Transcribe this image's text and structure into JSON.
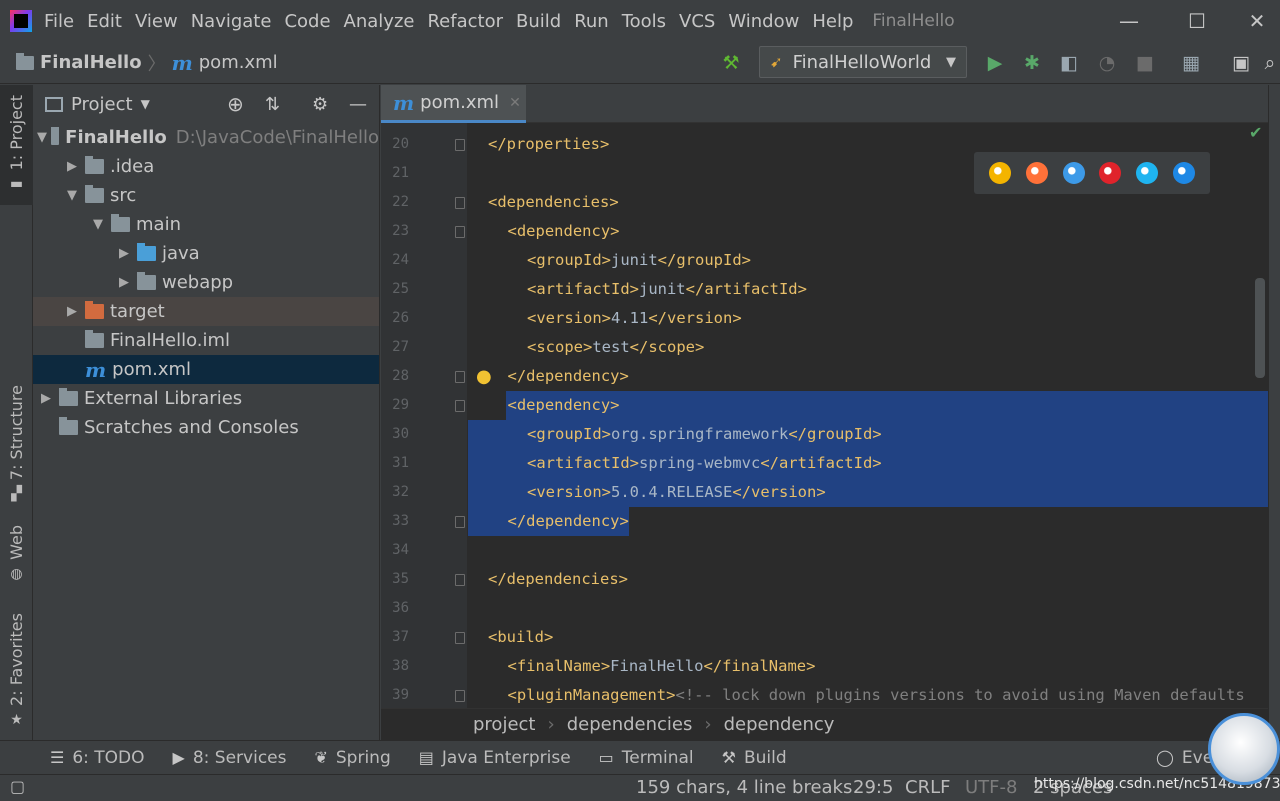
{
  "window": {
    "menu": [
      "File",
      "Edit",
      "View",
      "Navigate",
      "Code",
      "Analyze",
      "Refactor",
      "Build",
      "Run",
      "Tools",
      "VCS",
      "Window",
      "Help"
    ],
    "title": "FinalHello",
    "minimize": "—",
    "maximize": "☐",
    "close": "✕"
  },
  "navbar": {
    "project": "FinalHello",
    "file": "pom.xml",
    "run_config": "FinalHelloWorld"
  },
  "left_strip": {
    "project": "1: Project",
    "structure": "7: Structure",
    "web": "Web",
    "favorites": "2: Favorites"
  },
  "project_panel": {
    "title": "Project",
    "tree": [
      {
        "label": "FinalHello",
        "hint": "D:\\JavaCode\\FinalHello",
        "arrow": "▼",
        "indent": 0,
        "icon": "module-icon",
        "color": "#87939a"
      },
      {
        "label": ".idea",
        "arrow": "▶",
        "indent": 1,
        "icon": "folder-icon",
        "color": "#87939a"
      },
      {
        "label": "src",
        "arrow": "▼",
        "indent": 1,
        "icon": "folder-icon",
        "color": "#87939a"
      },
      {
        "label": "main",
        "arrow": "▼",
        "indent": 2,
        "icon": "folder-icon",
        "color": "#87939a"
      },
      {
        "label": "java",
        "arrow": "▶",
        "indent": 3,
        "icon": "source-folder-icon",
        "color": "#4a9fd8"
      },
      {
        "label": "webapp",
        "arrow": "▶",
        "indent": 3,
        "icon": "web-folder-icon",
        "color": "#87939a"
      },
      {
        "label": "target",
        "arrow": "▶",
        "indent": 1,
        "icon": "excluded-folder-icon",
        "color": "#d26b3f"
      },
      {
        "label": "FinalHello.iml",
        "arrow": "",
        "indent": 1,
        "icon": "iml-file-icon",
        "color": "#87939a"
      },
      {
        "label": "pom.xml",
        "arrow": "",
        "indent": 1,
        "icon": "maven-file-icon",
        "color": "#3d8fd8"
      },
      {
        "label": "External Libraries",
        "arrow": "▶",
        "indent": 0,
        "icon": "libraries-icon",
        "color": "#87939a"
      },
      {
        "label": "Scratches and Consoles",
        "arrow": "",
        "indent": 0,
        "icon": "scratches-icon",
        "color": "#87939a"
      }
    ]
  },
  "editor": {
    "tab": "pom.xml",
    "lines": [
      {
        "no": "20",
        "indent": 0,
        "text": "</properties>"
      },
      {
        "no": "21",
        "indent": 0,
        "text": ""
      },
      {
        "no": "22",
        "indent": 0,
        "text": "<dependencies>"
      },
      {
        "no": "23",
        "indent": 1,
        "text": "<dependency>"
      },
      {
        "no": "24",
        "indent": 2,
        "text": "<groupId>junit</groupId>"
      },
      {
        "no": "25",
        "indent": 2,
        "text": "<artifactId>junit</artifactId>"
      },
      {
        "no": "26",
        "indent": 2,
        "text": "<version>4.11</version>"
      },
      {
        "no": "27",
        "indent": 2,
        "text": "<scope>test</scope>"
      },
      {
        "no": "28",
        "indent": 1,
        "text": "</dependency>"
      },
      {
        "no": "29",
        "indent": 1,
        "text": "<dependency>"
      },
      {
        "no": "30",
        "indent": 2,
        "text": "<groupId>org.springframework</groupId>"
      },
      {
        "no": "31",
        "indent": 2,
        "text": "<artifactId>spring-webmvc</artifactId>"
      },
      {
        "no": "32",
        "indent": 2,
        "text": "<version>5.0.4.RELEASE</version>"
      },
      {
        "no": "33",
        "indent": 1,
        "text": "</dependency>"
      },
      {
        "no": "34",
        "indent": 0,
        "text": ""
      },
      {
        "no": "35",
        "indent": 0,
        "text": "</dependencies>"
      },
      {
        "no": "36",
        "indent": 0,
        "text": ""
      },
      {
        "no": "37",
        "indent": 0,
        "text": "<build>"
      },
      {
        "no": "38",
        "indent": 1,
        "text": "<finalName>FinalHello</finalName>"
      },
      {
        "no": "39",
        "indent": 1,
        "text": "<pluginManagement><!-- lock down plugins versions to avoid using Maven defaults"
      }
    ],
    "selection_lines": [
      "29",
      "30",
      "31",
      "32",
      "33"
    ],
    "colors": {
      "tag": "#e8bf6a",
      "comment": "#808080",
      "selection": "#214283",
      "text": "#a9b7c6"
    }
  },
  "browsers": [
    {
      "name": "chrome-icon",
      "color": "#f4b400"
    },
    {
      "name": "firefox-icon",
      "color": "#ff7139"
    },
    {
      "name": "safari-icon",
      "color": "#3d9ae8"
    },
    {
      "name": "opera-icon",
      "color": "#e0232b"
    },
    {
      "name": "ie-icon",
      "color": "#1fb4f0"
    },
    {
      "name": "edge-icon",
      "color": "#1e88e5"
    }
  ],
  "breadcrumb": [
    "project",
    "dependencies",
    "dependency"
  ],
  "bottom_tools": {
    "todo": "6: TODO",
    "services": "8: Services",
    "spring": "Spring",
    "java_enterprise": "Java Enterprise",
    "terminal": "Terminal",
    "build": "Build",
    "event_log": "Even"
  },
  "status": {
    "selection_info": "159 chars, 4 line breaks",
    "position": "29:5",
    "line_sep": "CRLF",
    "encoding": "UTF-8",
    "indent": "2 spaces",
    "watermark": "https://blog.csdn.net/nc514819873"
  }
}
